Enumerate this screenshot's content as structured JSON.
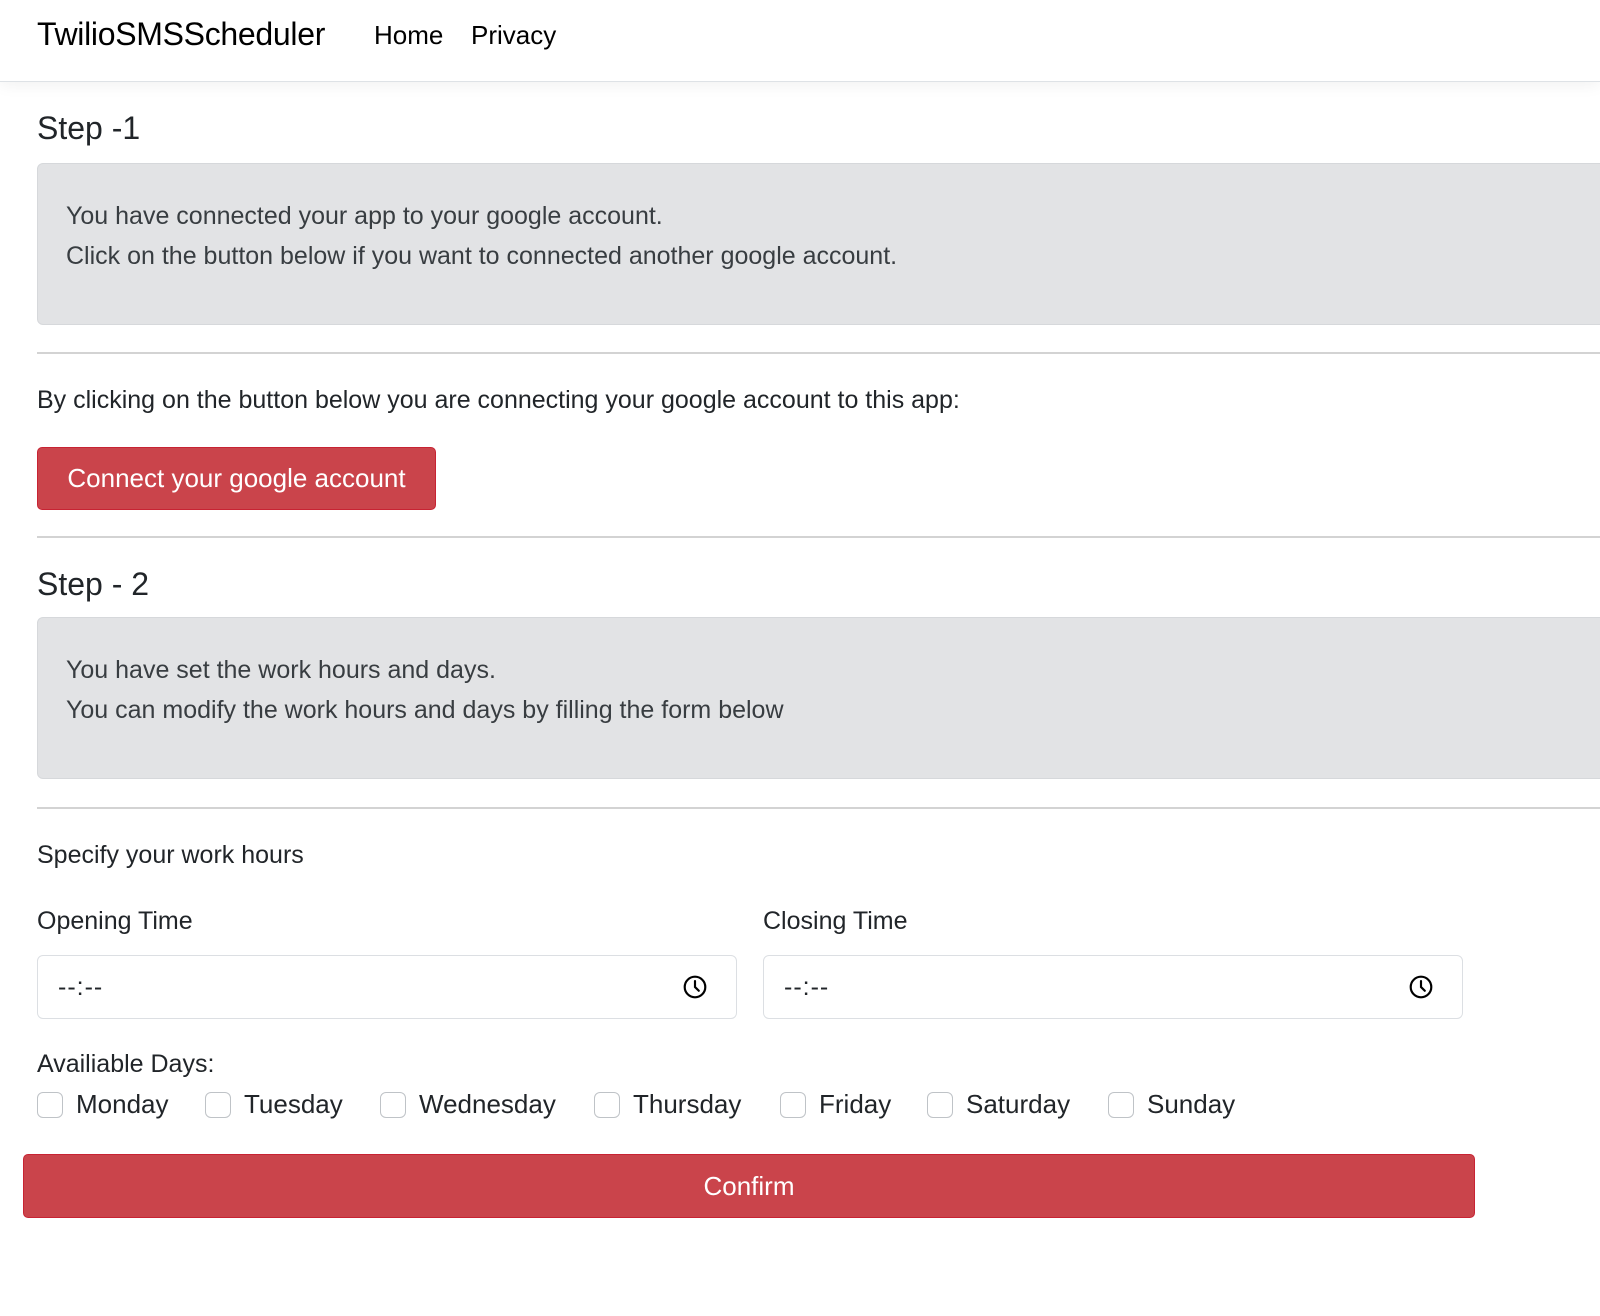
{
  "navbar": {
    "brand": "TwilioSMSScheduler",
    "links": [
      {
        "label": "Home"
      },
      {
        "label": "Privacy"
      }
    ]
  },
  "step1": {
    "title": "Step -1",
    "info_lines": [
      "You have connected your app to your google account.",
      "Click on the button below if you want to connected another google account."
    ],
    "connect_prompt": "By clicking on the button below you are connecting your google account to this app:",
    "connect_button": "Connect your google account"
  },
  "step2": {
    "title": "Step - 2",
    "info_lines": [
      "You have set the work hours and days.",
      "You can modify the work hours and days by filling the form below"
    ]
  },
  "form": {
    "work_hours_label": "Specify your work hours",
    "opening_time": {
      "label": "Opening Time",
      "value": "--:--",
      "icon": "clock-icon"
    },
    "closing_time": {
      "label": "Closing Time",
      "value": "--:--",
      "icon": "clock-icon"
    },
    "days_label": "Availiable Days:",
    "days": [
      {
        "label": "Monday",
        "checked": false
      },
      {
        "label": "Tuesday",
        "checked": false
      },
      {
        "label": "Wednesday",
        "checked": false
      },
      {
        "label": "Thursday",
        "checked": false
      },
      {
        "label": "Friday",
        "checked": false
      },
      {
        "label": "Saturday",
        "checked": false
      },
      {
        "label": "Sunday",
        "checked": false
      }
    ],
    "confirm_button": "Confirm"
  },
  "colors": {
    "danger": "#ca444b",
    "info_bg": "#e2e3e5",
    "info_text": "#383d41"
  }
}
